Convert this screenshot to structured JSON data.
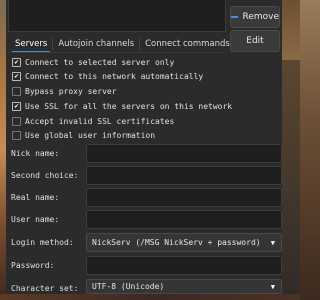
{
  "buttons": {
    "remove_label": "Remove",
    "edit_label": "Edit"
  },
  "tabs": [
    {
      "label": "Servers",
      "active": true
    },
    {
      "label": "Autojoin channels",
      "active": false
    },
    {
      "label": "Connect commands",
      "active": false
    }
  ],
  "options": [
    {
      "label": "Connect to selected server only",
      "checked": true
    },
    {
      "label": "Connect to this network automatically",
      "checked": true
    },
    {
      "label": "Bypass proxy server",
      "checked": false
    },
    {
      "label": "Use SSL for all the servers on this network",
      "checked": true
    },
    {
      "label": "Accept invalid SSL certificates",
      "checked": false
    },
    {
      "label": "Use global user information",
      "checked": false
    }
  ],
  "fields": {
    "nick_name": {
      "label": "Nick name:",
      "value": ""
    },
    "second_choice": {
      "label": "Second choice:",
      "value": ""
    },
    "real_name": {
      "label": "Real name:",
      "value": ""
    },
    "user_name": {
      "label": "User name:",
      "value": ""
    },
    "login_method": {
      "label": "Login method:",
      "value": "NickServ (/MSG NickServ + password)"
    },
    "password": {
      "label": "Password:",
      "value": ""
    },
    "character_set": {
      "label": "Character set:",
      "value": "UTF-8 (Unicode)"
    }
  },
  "colors": {
    "accent": "#3d8fd6",
    "dialog_bg": "#2b2b2b",
    "input_bg": "#1e1e1e"
  },
  "icons": {
    "remove": "minus-icon",
    "dropdown": "chevron-down-icon",
    "check": "checkmark-icon"
  }
}
